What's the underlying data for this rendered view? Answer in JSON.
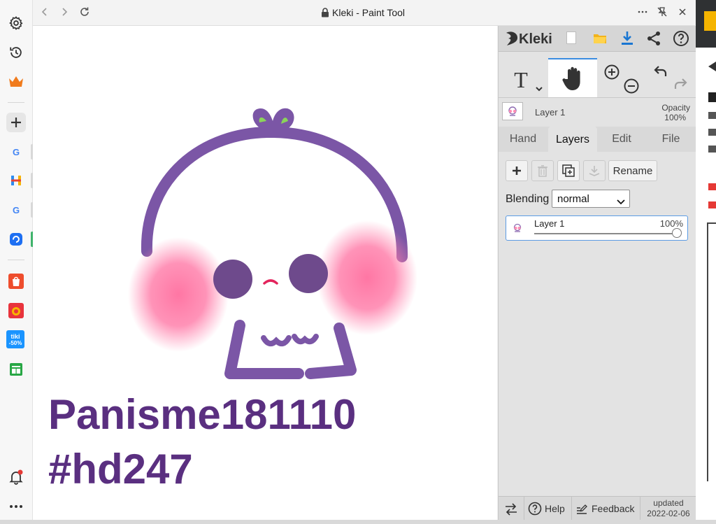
{
  "window": {
    "title": "Kleki - Paint Tool"
  },
  "canvas": {
    "line1": "Panisme181110",
    "line2": "#hd247"
  },
  "kleki": {
    "brand": "Kleki",
    "top_layer_name": "Layer 1",
    "opacity_label": "Opacity",
    "opacity_value": "100%",
    "tabs": [
      "Hand",
      "Layers",
      "Edit",
      "File"
    ],
    "active_tab": "Layers",
    "rename_label": "Rename",
    "blending_label": "Blending",
    "blending_value": "normal",
    "layer": {
      "name": "Layer 1",
      "opacity": "100%",
      "opacity_fraction": 1.0
    },
    "footer": {
      "help": "Help",
      "feedback": "Feedback",
      "updated_label": "updated",
      "updated_date": "2022-02-06"
    }
  },
  "sidebar": {
    "icons": [
      "gear-icon",
      "history-icon",
      "crown-icon",
      "plus-icon",
      "google-icon",
      "h-app-icon",
      "google-icon",
      "messenger-icon",
      "shopee-icon",
      "lazada-icon",
      "tiki-icon",
      "sheet-icon",
      "bell-icon",
      "more-icon"
    ],
    "tiki_badge": "tiki",
    "tiki_discount": "-50%"
  },
  "colors": {
    "purple": "#7b56a6",
    "cheek": "#ff6f9f",
    "text_purple": "#5a2f80",
    "accent_blue": "#3b8ce0"
  }
}
